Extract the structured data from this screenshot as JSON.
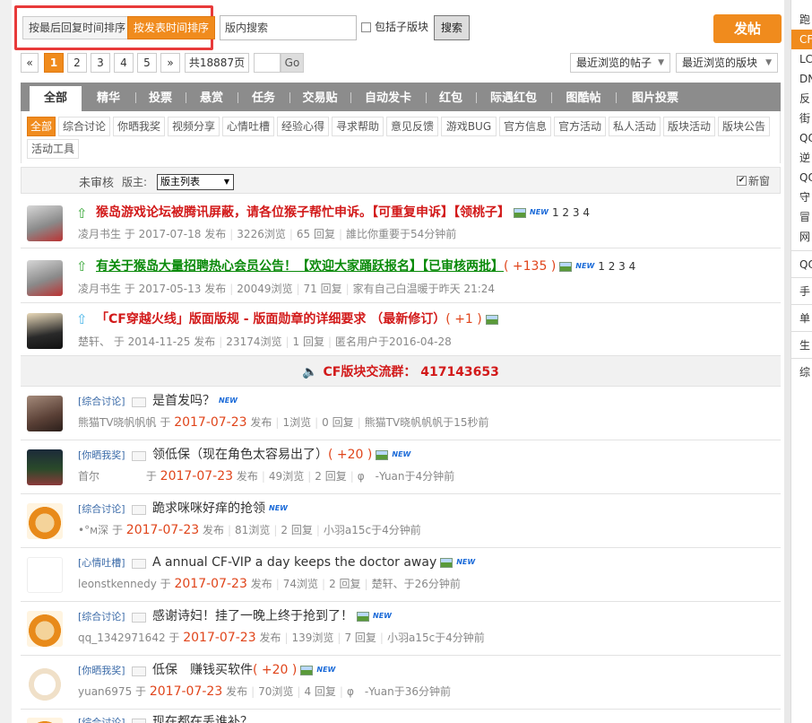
{
  "sort": {
    "by_reply": "按最后回复时间排序",
    "by_post": "按发表时间排序"
  },
  "search": {
    "placeholder": "版内搜索",
    "include_sub": "包括子版块",
    "button": "搜索"
  },
  "post_button": "发帖",
  "pager": {
    "prev": "«",
    "pages": [
      "1",
      "2",
      "3",
      "4",
      "5"
    ],
    "next": "»",
    "total": "共18887页",
    "go": "Go"
  },
  "recent": {
    "threads": "最近浏览的帖子",
    "forums": "最近浏览的版块"
  },
  "tabs": [
    "全部",
    "精华",
    "投票",
    "悬赏",
    "任务",
    "交易贴",
    "自动发卡",
    "红包",
    "际遇红包",
    "图酷帖",
    "图片投票"
  ],
  "types": [
    "全部",
    "综合讨论",
    "你晒我奖",
    "视频分享",
    "心情吐槽",
    "经验心得",
    "寻求帮助",
    "意见反馈",
    "游戏BUG",
    "官方信息",
    "官方活动",
    "私人活动",
    "版块活动",
    "版块公告",
    "活动工具"
  ],
  "header": {
    "unreviewed": "未审核",
    "moderator": "版主:",
    "mod_select": "版主列表",
    "new_window": "新窗"
  },
  "sticky": [
    {
      "title": "猴岛游戏论坛被腾讯屏蔽，请各位猴子帮忙申诉。【可重复申诉】【领桃子】",
      "pages": "1 2 3 4",
      "author": "凌月书生",
      "date": "2017-07-18",
      "verb": "发布",
      "views": "3226浏览",
      "replies": "65 回复",
      "last": "誰比你重要于54分钟前"
    },
    {
      "title": "有关于猴岛大量招聘热心会员公告！【欢迎大家踊跃报名】【已审核两批】",
      "bonus": "( +135 )",
      "pages": "1 2 3 4",
      "author": "凌月书生",
      "date": "2017-05-13",
      "verb": "发布",
      "views": "20049浏览",
      "replies": "71 回复",
      "last": "家有自己白温暖于昨天 21:24"
    },
    {
      "title": "「CF穿越火线」版面版规 - 版面勋章的详细要求 （最新修订）",
      "bonus": "( +1 )",
      "author": "楚轩、",
      "date": "2014-11-25",
      "verb": "发布",
      "views": "23174浏览",
      "replies": "1 回复",
      "last": "匿名用户于2016-04-28"
    }
  ],
  "qq_group": "CF版块交流群： 417143653",
  "threads": [
    {
      "cat": "[综合讨论]",
      "title": "是首发吗？",
      "author": "熊猫TV晓帆帆帆",
      "date": "2017-07-23",
      "verb": "发布",
      "views": "1浏览",
      "replies": "0 回复",
      "last": "熊猫TV晓帆帆帆于15秒前"
    },
    {
      "cat": "[你晒我奖]",
      "title": "领低保（现在角色太容易出了）",
      "bonus": "( +20 )",
      "author": "首尔",
      "date": "2017-07-23",
      "verb": "发布",
      "views": "49浏览",
      "replies": "2 回复",
      "last": "φ　-Yuan于4分钟前"
    },
    {
      "cat": "[综合讨论]",
      "title": "跪求咪咪好痒的抢领",
      "author": "•°м深",
      "date": "2017-07-23",
      "verb": "发布",
      "views": "81浏览",
      "replies": "2 回复",
      "last": "小羽a15c于4分钟前"
    },
    {
      "cat": "[心情吐槽]",
      "title": "A annual CF-VIP a day keeps the doctor away",
      "author": "leonstkennedy",
      "date": "2017-07-23",
      "verb": "发布",
      "views": "74浏览",
      "replies": "2 回复",
      "last": "楚轩、于26分钟前"
    },
    {
      "cat": "[综合讨论]",
      "title": "感谢诗妇！挂了一晚上终于抢到了！",
      "author": "qq_1342971642",
      "date": "2017-07-23",
      "verb": "发布",
      "views": "139浏览",
      "replies": "7 回复",
      "last": "小羽a15c于4分钟前"
    },
    {
      "cat": "[你晒我奖]",
      "title": "低保　赚钱买软件",
      "bonus": "( +20 )",
      "author": "yuan6975",
      "date": "2017-07-23",
      "verb": "发布",
      "views": "70浏览",
      "replies": "4 回复",
      "last": "φ　-Yuan于36分钟前"
    },
    {
      "cat": "[综合讨论]",
      "title": "现在都在丢谁补？"
    }
  ],
  "right_panel": [
    "跑",
    "CF",
    "LC",
    "DN",
    "反",
    "街",
    "QQ",
    "逆",
    "QQ",
    "守",
    "冒",
    "网",
    "QQ",
    "手",
    "单",
    "生",
    "综"
  ],
  "colors": {
    "accent": "#f08b1d",
    "sticky_red": "#d21a1a",
    "sticky_green": "#0a8a0a",
    "date_red": "#e0451b",
    "highlight_box": "#e83a3a"
  }
}
